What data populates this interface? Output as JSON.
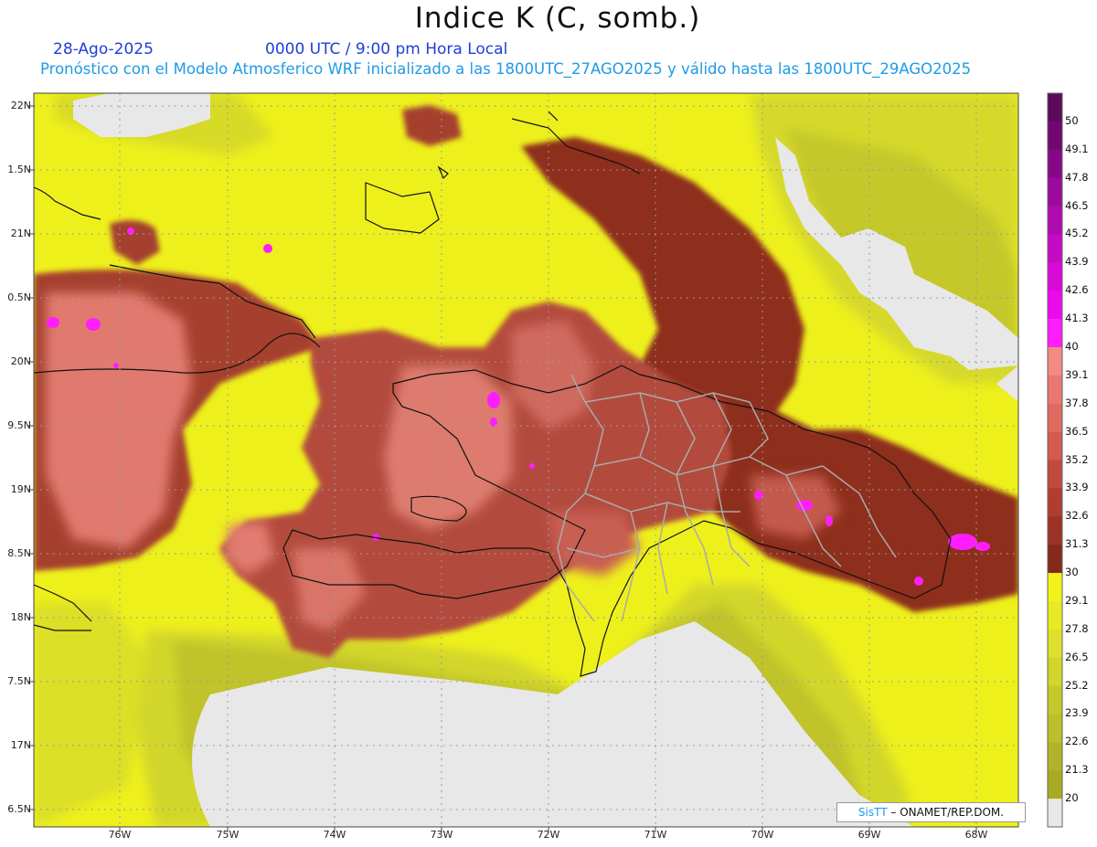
{
  "header": {
    "title": "Indice K (C, somb.)",
    "date": "28-Ago-2025",
    "time": "0000 UTC / 9:00 pm Hora Local",
    "description": "Pronóstico con el Modelo Atmosferico WRF inicializado a las 1800UTC_27AGO2025 y válido hasta las  1800UTC_29AGO2025"
  },
  "axes": {
    "lat_labels": [
      "22N",
      "1.5N",
      "21N",
      "0.5N",
      "20N",
      "9.5N",
      "19N",
      "8.5N",
      "18N",
      "7.5N",
      "17N",
      "6.5N"
    ],
    "lon_labels": [
      "76W",
      "75W",
      "74W",
      "73W",
      "72W",
      "71W",
      "70W",
      "69W",
      "68W"
    ]
  },
  "colorbar": {
    "ticks": [
      "50",
      "49.1",
      "47.8",
      "46.5",
      "45.2",
      "43.9",
      "42.6",
      "41.3",
      "40",
      "39.1",
      "37.8",
      "36.5",
      "35.2",
      "33.9",
      "32.6",
      "31.3",
      "30",
      "29.1",
      "27.8",
      "26.5",
      "25.2",
      "23.9",
      "22.6",
      "21.3",
      "20"
    ],
    "colors": [
      "#5c0a5c",
      "#71076f",
      "#860886",
      "#9c0a9c",
      "#b00ab0",
      "#c50ac5",
      "#d90ad9",
      "#ec0aec",
      "#ff1dff",
      "#f48a84",
      "#ea7870",
      "#df6a60",
      "#d25a50",
      "#c14a3e",
      "#b03d30",
      "#9c3226",
      "#84291b",
      "#f2f21a",
      "#e8eb22",
      "#dde02a",
      "#d2d52a",
      "#c6c92a",
      "#bcbf2a",
      "#b1b42a",
      "#a8ab22",
      "#e8e8e8"
    ]
  },
  "credit": {
    "brand": "SisTT",
    "org": " – ONAMET/REP.DOM."
  }
}
